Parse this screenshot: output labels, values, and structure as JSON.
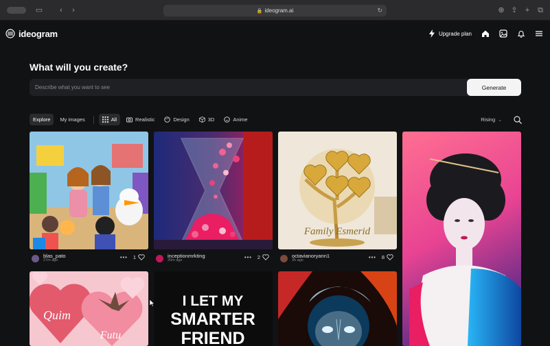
{
  "browser": {
    "url": "ideogram.ai"
  },
  "app": {
    "name": "ideogram",
    "upgrade_label": "Upgrade plan"
  },
  "hero": {
    "title": "What will you create?",
    "placeholder": "Describe what you want to see",
    "generate_label": "Generate"
  },
  "filters": {
    "tabs": [
      "Explore",
      "My images"
    ],
    "styles": [
      "All",
      "Realistic",
      "Design",
      "3D",
      "Anime"
    ],
    "sort": "Rising"
  },
  "cards": [
    {
      "user": "blas_pato",
      "age": "27m ago",
      "likes": "1",
      "avatar_color": "#6a5a8a"
    },
    {
      "user": "inceptionmrkting",
      "age": "20m ago",
      "likes": "2",
      "avatar_color": "#c2185b"
    },
    {
      "user": "octavianoryann1",
      "age": "3h ago",
      "likes": "8",
      "avatar_color": "#7a4a3a"
    }
  ],
  "poster_text": {
    "line1": "I LET MY",
    "line2": "SMARTER",
    "line3": "FRIEND"
  },
  "heart_text": {
    "name1": "Quim",
    "name2": "Futu"
  },
  "tree_text": {
    "banner": "Family Esmerid"
  }
}
